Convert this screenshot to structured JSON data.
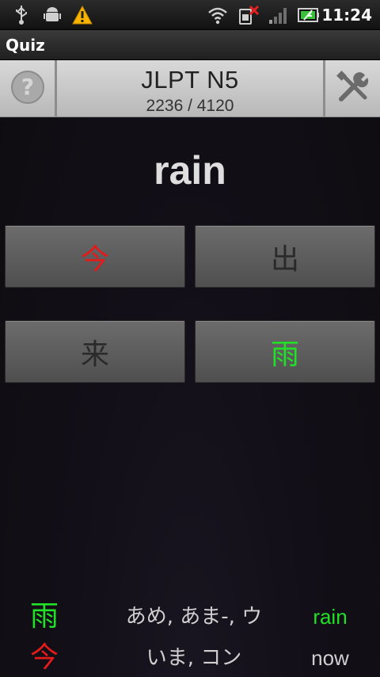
{
  "status_bar": {
    "time": "11:24",
    "icons": [
      "usb-icon",
      "android-debug-icon",
      "warning-icon",
      "wifi-icon",
      "no-sim-icon",
      "signal-icon",
      "battery-charging-icon"
    ]
  },
  "app": {
    "title": "Quiz"
  },
  "header": {
    "level": "JLPT N5",
    "progress": "2236 / 4120",
    "help_icon": "question-icon",
    "settings_icon": "tools-icon"
  },
  "question": {
    "word": "rain"
  },
  "answers": [
    {
      "kanji": "今",
      "state": "wrong",
      "color": "#e21a1a"
    },
    {
      "kanji": "出",
      "state": "neutral",
      "color": "#2a2a2a"
    },
    {
      "kanji": "来",
      "state": "neutral",
      "color": "#2a2a2a"
    },
    {
      "kanji": "雨",
      "state": "correct",
      "color": "#22e028"
    }
  ],
  "history": [
    {
      "kanji": "雨",
      "reading": "あめ, あま-, ウ",
      "meaning": "rain",
      "result": "correct"
    },
    {
      "kanji": "今",
      "reading": "いま, コン",
      "meaning": "now",
      "result": "wrong"
    }
  ],
  "colors": {
    "correct": "#22e028",
    "wrong": "#e21a1a",
    "neutral": "#2a2a2a"
  }
}
